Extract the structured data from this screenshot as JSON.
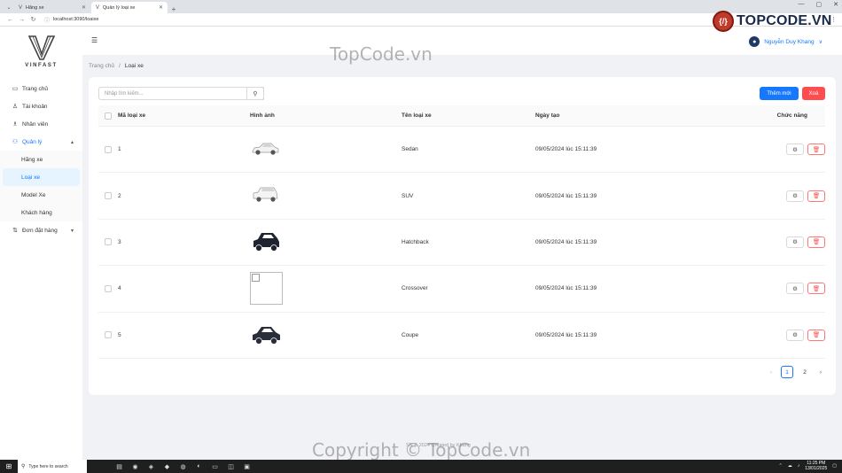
{
  "browser": {
    "tabs": [
      {
        "icon": "V",
        "title": "Hãng xe",
        "active": false
      },
      {
        "icon": "V",
        "title": "Quản lý loại xe",
        "active": true
      }
    ],
    "url": "localhost:3090/loaixe"
  },
  "brand": {
    "name": "VINFAST"
  },
  "sidebar": {
    "items": [
      {
        "icon": "▭",
        "label": "Trang chủ"
      },
      {
        "icon": "♙",
        "label": "Tài khoản"
      },
      {
        "icon": "♗",
        "label": "Nhân viên"
      }
    ],
    "group": {
      "icon": "⚇",
      "label": "Quản lý",
      "arrow": "▴"
    },
    "sub_items": [
      {
        "label": "Hãng xe",
        "active": false
      },
      {
        "label": "Loại xe",
        "active": true
      },
      {
        "label": "Model Xe",
        "active": false
      },
      {
        "label": "Khách hàng",
        "active": false
      }
    ],
    "orders": {
      "icon": "⇅",
      "label": "Đơn đặt hàng",
      "arrow": "▾"
    }
  },
  "header": {
    "user_name": "Nguyễn Duy Khang"
  },
  "watermark": {
    "logo_text": "TOPCODE.VN",
    "center": "TopCode.vn",
    "bottom": "Copyright © TopCode.vn"
  },
  "breadcrumb": {
    "home": "Trang chủ",
    "separator": "/",
    "current": "Loại xe"
  },
  "toolbar": {
    "search_placeholder": "Nhập tìm kiếm...",
    "add_label": "Thêm mới",
    "delete_label": "Xoá"
  },
  "table": {
    "headers": [
      "Mã loại xe",
      "Hình ảnh",
      "Tên loại xe",
      "Ngày tạo",
      "Chức năng"
    ],
    "rows": [
      {
        "id": "1",
        "image": "sedan-white",
        "name": "Sedan",
        "created": "09/05/2024 lúc 15:11:39"
      },
      {
        "id": "2",
        "image": "suv-white",
        "name": "SUV",
        "created": "09/05/2024 lúc 15:11:39"
      },
      {
        "id": "3",
        "image": "hatchback-dark",
        "name": "Hatchback",
        "created": "09/05/2024 lúc 15:11:39"
      },
      {
        "id": "4",
        "image": "broken",
        "name": "Crossover",
        "created": "09/05/2024 lúc 15:11:39"
      },
      {
        "id": "5",
        "image": "coupe-dark",
        "name": "Coupe",
        "created": "09/05/2024 lúc 15:11:39"
      }
    ]
  },
  "pagination": {
    "pages": [
      "1",
      "2"
    ],
    "current": "1"
  },
  "footer": {
    "text": "SN © 2024 Created by Khang"
  },
  "taskbar": {
    "search_placeholder": "Type here to search",
    "time": "11:25 PM",
    "date": "13/01/2025"
  },
  "colors": {
    "primary": "#1677ff",
    "danger": "#ff4d4f",
    "sidebar_active_bg": "#e6f4ff"
  }
}
